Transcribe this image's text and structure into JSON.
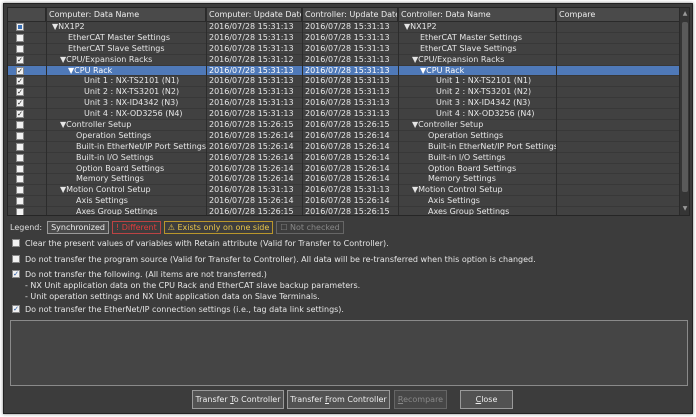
{
  "columns": [
    "Computer: Data Name",
    "Computer: Update Date",
    "Controller: Update Date",
    "Controller: Data Name",
    "Compare"
  ],
  "rows": [
    {
      "check": "ind",
      "comp_name": "▼NX1P2",
      "comp_date": "2016/07/28 15:31:13",
      "ctrl_date": "2016/07/28 15:31:13",
      "ctrl_name": "▼NX1P2",
      "indent": 0,
      "sel": false
    },
    {
      "check": "off",
      "comp_name": "EtherCAT Master Settings",
      "comp_date": "2016/07/28 15:31:13",
      "ctrl_date": "2016/07/28 15:31:13",
      "ctrl_name": "EtherCAT Master Settings",
      "indent": 2,
      "sel": false
    },
    {
      "check": "off",
      "comp_name": "EtherCAT Slave Settings",
      "comp_date": "2016/07/28 15:31:13",
      "ctrl_date": "2016/07/28 15:31:13",
      "ctrl_name": "EtherCAT Slave Settings",
      "indent": 2,
      "sel": false
    },
    {
      "check": "on",
      "comp_name": "▼CPU/Expansion Racks",
      "comp_date": "2016/07/28 15:31:12",
      "ctrl_date": "2016/07/28 15:31:13",
      "ctrl_name": "▼CPU/Expansion Racks",
      "indent": 1,
      "sel": false
    },
    {
      "check": "on",
      "comp_name": "▼CPU Rack",
      "comp_date": "2016/07/28 15:31:13",
      "ctrl_date": "2016/07/28 15:31:13",
      "ctrl_name": "▼CPU Rack",
      "indent": 2,
      "sel": true
    },
    {
      "check": "on",
      "comp_name": "Unit 1 : NX-TS2101 (N1)",
      "comp_date": "2016/07/28 15:31:13",
      "ctrl_date": "2016/07/28 15:31:13",
      "ctrl_name": "Unit 1 : NX-TS2101 (N1)",
      "indent": 4,
      "sel": false
    },
    {
      "check": "on",
      "comp_name": "Unit 2 : NX-TS3201 (N2)",
      "comp_date": "2016/07/28 15:31:13",
      "ctrl_date": "2016/07/28 15:31:13",
      "ctrl_name": "Unit 2 : NX-TS3201 (N2)",
      "indent": 4,
      "sel": false
    },
    {
      "check": "on",
      "comp_name": "Unit 3 : NX-ID4342 (N3)",
      "comp_date": "2016/07/28 15:31:13",
      "ctrl_date": "2016/07/28 15:31:13",
      "ctrl_name": "Unit 3 : NX-ID4342 (N3)",
      "indent": 4,
      "sel": false
    },
    {
      "check": "on",
      "comp_name": "Unit 4 : NX-OD3256 (N4)",
      "comp_date": "2016/07/28 15:31:13",
      "ctrl_date": "2016/07/28 15:31:13",
      "ctrl_name": "Unit 4 : NX-OD3256 (N4)",
      "indent": 4,
      "sel": false
    },
    {
      "check": "off",
      "comp_name": "▼Controller Setup",
      "comp_date": "2016/07/28 15:26:15",
      "ctrl_date": "2016/07/28 15:26:15",
      "ctrl_name": "▼Controller Setup",
      "indent": 1,
      "sel": false
    },
    {
      "check": "off",
      "comp_name": "Operation Settings",
      "comp_date": "2016/07/28 15:26:14",
      "ctrl_date": "2016/07/28 15:26:14",
      "ctrl_name": "Operation Settings",
      "indent": 3,
      "sel": false
    },
    {
      "check": "off",
      "comp_name": "Built-in EtherNet/IP Port Settings",
      "comp_date": "2016/07/28 15:26:14",
      "ctrl_date": "2016/07/28 15:26:14",
      "ctrl_name": "Built-in EtherNet/IP Port Settings",
      "indent": 3,
      "sel": false
    },
    {
      "check": "off",
      "comp_name": "Built-in I/O Settings",
      "comp_date": "2016/07/28 15:26:14",
      "ctrl_date": "2016/07/28 15:26:14",
      "ctrl_name": "Built-in I/O Settings",
      "indent": 3,
      "sel": false
    },
    {
      "check": "off",
      "comp_name": "Option Board Settings",
      "comp_date": "2016/07/28 15:26:14",
      "ctrl_date": "2016/07/28 15:26:14",
      "ctrl_name": "Option Board Settings",
      "indent": 3,
      "sel": false
    },
    {
      "check": "off",
      "comp_name": "Memory Settings",
      "comp_date": "2016/07/28 15:26:14",
      "ctrl_date": "2016/07/28 15:26:14",
      "ctrl_name": "Memory Settings",
      "indent": 3,
      "sel": false
    },
    {
      "check": "off",
      "comp_name": "▼Motion Control Setup",
      "comp_date": "2016/07/28 15:31:13",
      "ctrl_date": "2016/07/28 15:31:13",
      "ctrl_name": "▼Motion Control Setup",
      "indent": 1,
      "sel": false
    },
    {
      "check": "off",
      "comp_name": "Axis Settings",
      "comp_date": "2016/07/28 15:26:14",
      "ctrl_date": "2016/07/28 15:26:14",
      "ctrl_name": "Axis Settings",
      "indent": 3,
      "sel": false
    },
    {
      "check": "off",
      "comp_name": "Axes Group Settings",
      "comp_date": "2016/07/28 15:26:15",
      "ctrl_date": "2016/07/28 15:26:15",
      "ctrl_name": "Axes Group Settings",
      "indent": 3,
      "sel": false
    }
  ],
  "legend": {
    "label": "Legend:",
    "synchronized": "Synchronized",
    "different": "Different",
    "exists_one_side": "Exists only on one side",
    "not_checked": "Not checked"
  },
  "options": {
    "retain": {
      "text": "Clear the present values of variables with Retain attribute (Valid for Transfer to Controller).",
      "checked": false
    },
    "program_source": {
      "text": "Do not transfer the program source (Valid for Transfer to Controller). All data will be re-transferred when this option is changed.",
      "checked": false
    },
    "do_not_transfer": {
      "text": "Do not transfer the following. (All items are not transferred.)",
      "checked": true,
      "sub1": "- NX Unit application data on the CPU Rack and EtherCAT slave backup parameters.",
      "sub2": "- Unit operation settings and NX Unit application data on Slave Terminals."
    },
    "ethernet_ip": {
      "text": "Do not transfer the EtherNet/IP connection settings (i.e., tag data link settings).",
      "checked": true
    }
  },
  "buttons": {
    "transfer_to_pre": "Transfer ",
    "transfer_to_key": "T",
    "transfer_to_post": "o Controller",
    "transfer_from_pre": "Transfer ",
    "transfer_from_key": "F",
    "transfer_from_post": "rom Controller",
    "recompare_key": "R",
    "recompare_post": "ecompare",
    "close_key": "C",
    "close_post": "lose"
  },
  "colors": {
    "selected_row": "#4f79b8",
    "different": "#e03c3c",
    "exists": "#e8c54a"
  }
}
